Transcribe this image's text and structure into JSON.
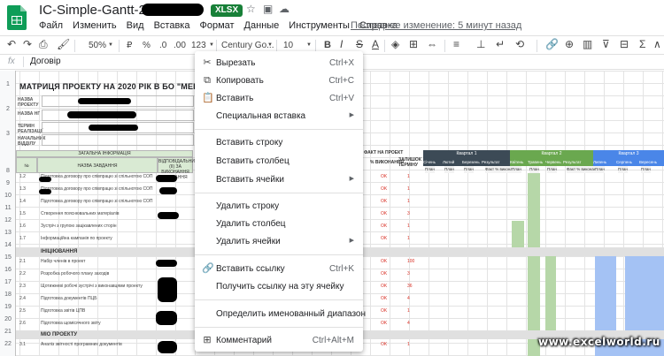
{
  "window": {
    "title": "IC-Simple-Gantt-2020",
    "file_type": "XLSX",
    "last_edit": "Последнее изменение: 5 минут назад"
  },
  "menubar": [
    "Файл",
    "Изменить",
    "Вид",
    "Вставка",
    "Формат",
    "Данные",
    "Инструменты",
    "Справка"
  ],
  "toolbar": {
    "zoom": "50%",
    "currency": "₽",
    "percent": "%",
    "decimal_less": ".0",
    "decimal_more": ".00",
    "format_more": "123",
    "font": "Century Go...",
    "font_size": "10",
    "bold": "B"
  },
  "formula_bar": {
    "label": "fx",
    "value": "Договір"
  },
  "sheet": {
    "title": "МАТРИЦЯ ПРОЕКТУ НА 2020 РІК В БО \"МЕРЕЖА ЗА",
    "info_labels": [
      "НАЗВА ПРОЕКТУ",
      "НАЗВА НГ",
      "ТЕРМІН РЕАЛІЗАЦІЇ",
      "НАЧАЛЬНИК ВІДДІЛУ"
    ],
    "general_info": "ЗАГАЛЬНА ІНФОРМАЦІЯ",
    "col_no": "№",
    "col_task": "НАЗВА ЗАВДАННЯ",
    "col_resp": "ВІДПОВІДАЛЬНИЙ (ІІ) ЗА ВИКОНАННЯ ЗАВДАННЯ",
    "fact_hdr": "ФАКТ НА ПРОЕКТ",
    "pct_hdr": "% ВИКОНАННЯ",
    "left_hdr": "ЗАЛИШОК ТЕРМІНУ",
    "sections": [
      "ІНІЦІЮВАННЯ",
      "МІО ПРОЕКТУ"
    ],
    "rows": [
      {
        "n": "1.2",
        "task": "Підготовка договору про співпрацю зі спільнотою СОП",
        "ok": "OK",
        "v": "1"
      },
      {
        "n": "1.3",
        "task": "Підготовка договору про співпрацю зі спільнотою СОП",
        "ok": "OK",
        "v": "1"
      },
      {
        "n": "1.4",
        "task": "Підготовка договору про співпрацю зі спільнотою СОП",
        "ok": "OK",
        "v": "1"
      },
      {
        "n": "1.5",
        "task": "Створення пояснювальних матеріалів",
        "ok": "OK",
        "v": "3"
      },
      {
        "n": "1.6",
        "task": "Зустріч з групою зацікавлених сторін",
        "ok": "OK",
        "v": "1"
      },
      {
        "n": "1.7",
        "task": "Інформаційна кампанія по проекту",
        "ok": "OK",
        "v": "1"
      },
      {
        "n": "2.1",
        "task": "Набір членів в проект",
        "ok": "OK",
        "v": "100"
      },
      {
        "n": "2.2",
        "task": "Розробка робочого плану заходів",
        "ok": "OK",
        "v": "3"
      },
      {
        "n": "2.3",
        "task": "Щотижневі робочі зустрічі з виконавцями проекту",
        "ok": "OK",
        "v": "36"
      },
      {
        "n": "2.4",
        "task": "Підготовка документів ПЦБ",
        "ok": "OK",
        "v": "4"
      },
      {
        "n": "2.5",
        "task": "Підготовка звітів ЦПВ",
        "ok": "OK",
        "v": "1"
      },
      {
        "n": "2.6",
        "task": "Підготовка щомісячного звіту",
        "ok": "OK",
        "v": "4"
      },
      {
        "n": "3.1",
        "task": "Аналіз звітності програмних документів",
        "ok": "OK",
        "v": "1"
      },
      {
        "n": "3.2",
        "task": "Моніторинг якості надання послуг",
        "ok": "OK",
        "v": "1"
      },
      {
        "n": "3.3",
        "task": "Моніторинг переведення функцій",
        "ok": "OK",
        "v": "1"
      }
    ]
  },
  "quarters": [
    {
      "label": "Квартал 1",
      "color": "#3c4a56",
      "months": [
        "Січень",
        "Лютий",
        "Березень",
        "Результат"
      ]
    },
    {
      "label": "Квартал 2",
      "color": "#6aa84f",
      "months": [
        "Квітень",
        "Травень",
        "Червень",
        "Результат"
      ]
    },
    {
      "label": "Квартал 3",
      "color": "#4a86e8",
      "months": [
        "Липень",
        "Серпень",
        "Вересень"
      ]
    }
  ],
  "plan_fact": [
    "План",
    "Факт",
    "План",
    "Факт",
    "План",
    "Факт",
    "Факт % виконання"
  ],
  "context_menu": {
    "items": [
      {
        "icon": "scissors-icon",
        "label": "Вырезать",
        "shortcut": "Ctrl+X"
      },
      {
        "icon": "copy-icon",
        "label": "Копировать",
        "shortcut": "Ctrl+C"
      },
      {
        "icon": "paste-icon",
        "label": "Вставить",
        "shortcut": "Ctrl+V"
      },
      {
        "label": "Специальная вставка",
        "submenu": true
      },
      {
        "label": "Вставить строку"
      },
      {
        "label": "Вставить столбец"
      },
      {
        "label": "Вставить ячейки",
        "submenu": true
      },
      {
        "label": "Удалить строку"
      },
      {
        "label": "Удалить столбец"
      },
      {
        "label": "Удалить ячейки",
        "submenu": true
      },
      {
        "icon": "link-icon",
        "label": "Вставить ссылку",
        "shortcut": "Ctrl+K"
      },
      {
        "label": "Получить ссылку на эту ячейку"
      },
      {
        "label": "Определить именованный диапазон"
      },
      {
        "icon": "comment-icon",
        "label": "Комментарий",
        "shortcut": "Ctrl+Alt+M"
      }
    ]
  },
  "watermark": "www.excelworld.ru",
  "colors": {
    "accent_green": "#188038",
    "quarter1": "#3c4a56",
    "quarter2": "#6aa84f",
    "quarter3": "#4a86e8",
    "ok_red": "#d93025"
  }
}
